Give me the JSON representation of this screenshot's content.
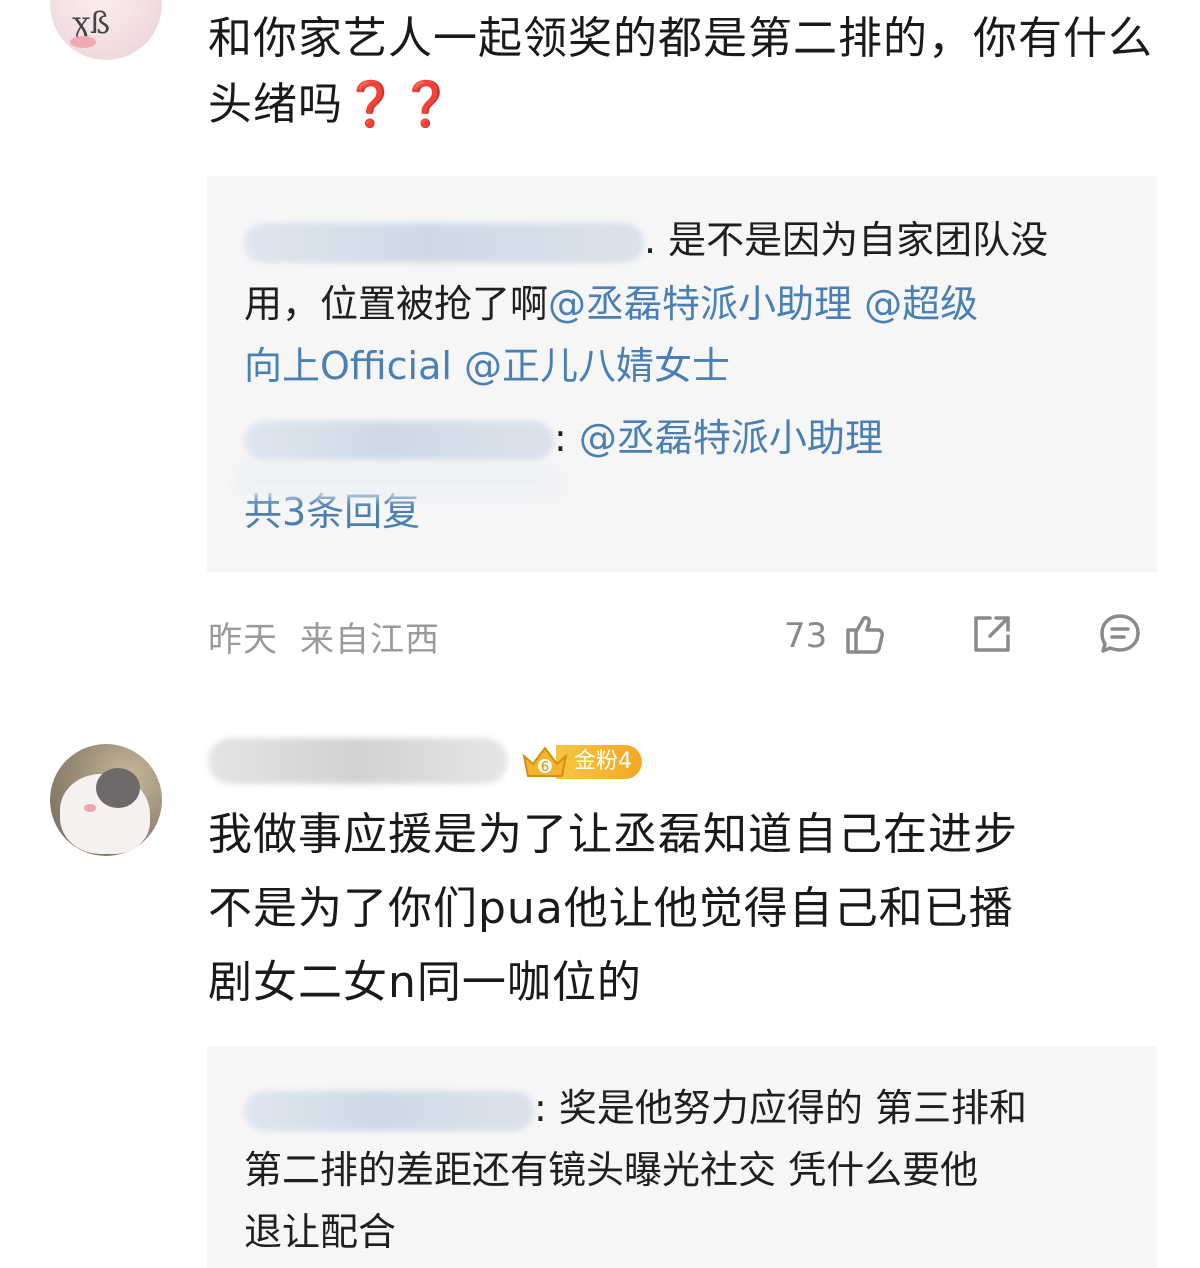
{
  "comments": [
    {
      "text": "和你家艺人一起领奖的都是第二排的，你有什么头绪吗",
      "emoji": "❓❓",
      "replies": {
        "reply1_text": ". 是不是因为自家团队没用，位置被抢了啊",
        "reply1_text_part1": ". 是不是因为自家团队没",
        "reply1_text_part2": "用，位置被抢了啊",
        "reply1_mentions": [
          "@丞磊特派小助理",
          "@超级向上Official",
          "@正儿八婧女士"
        ],
        "reply1_mention_1": "@丞磊特派小助理",
        "reply1_mention_2a": "@超级",
        "reply1_mention_2b": "向上Official",
        "reply1_mention_3": "@正儿八婧女士",
        "reply2_sep": ": ",
        "reply2_mention": "@丞磊特派小助理",
        "more_replies": "共3条回复"
      },
      "footer": {
        "time": "昨天",
        "location": "来自江西",
        "likes": "73"
      },
      "icons": [
        "thumbs-up-icon",
        "share-icon",
        "comment-icon"
      ]
    },
    {
      "badge": {
        "level": "6",
        "label": "金粉4"
      },
      "text_lines": [
        "我做事应援是为了让丞磊知道自己在进步",
        "不是为了你们pua他让他觉得自己和已播",
        "剧女二女n同一咖位的"
      ],
      "replies": {
        "reply_lines": [
          ": 奖是他努力应得的 第三排和",
          "第二排的差距还有镜头曝光社交 凭什么要他",
          "退让配合"
        ]
      }
    }
  ],
  "colors": {
    "mention": "#4a7fb3",
    "reply_bg": "#f6f6f7",
    "meta": "#9a9a9a",
    "badge": "#f3a824",
    "emoji": "#d42a2a"
  }
}
